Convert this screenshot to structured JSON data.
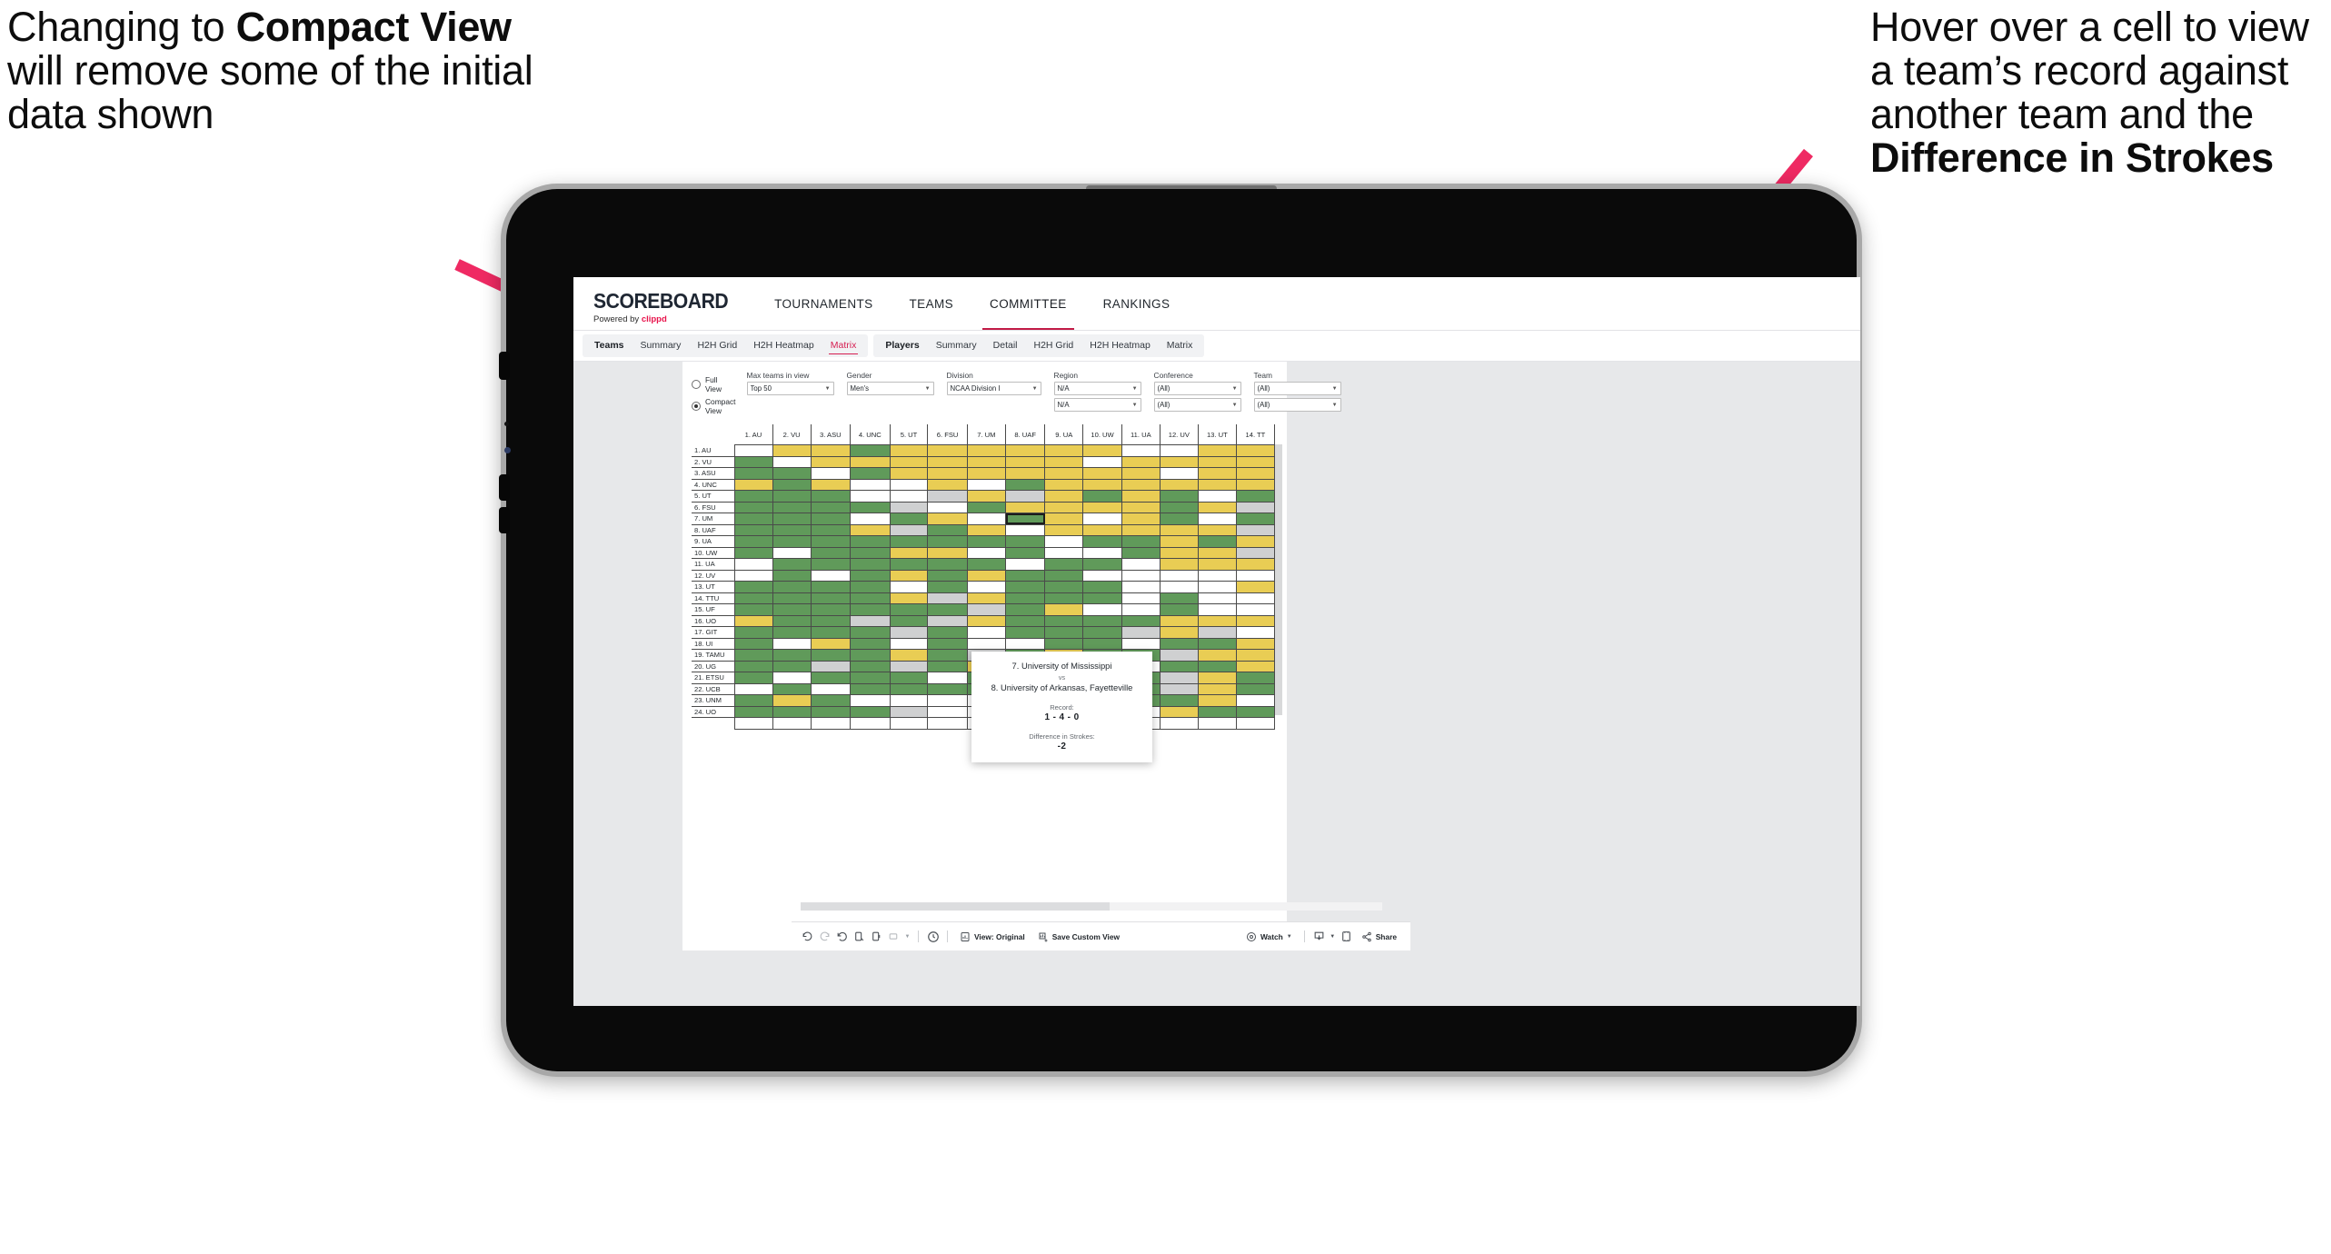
{
  "annotations": {
    "left": {
      "part1": "Changing to ",
      "bold": "Compact View",
      "part2": " will remove some of the initial data shown"
    },
    "right": {
      "part1": "Hover over a cell to view a team’s record against another team and the ",
      "bold": "Difference in Strokes",
      "part2": ""
    },
    "arrow_color": "#ef2a63"
  },
  "app": {
    "brand": {
      "title": "SCOREBOARD",
      "powered_prefix": "Powered by ",
      "powered_name": "clippd"
    },
    "topnav": [
      {
        "label": "TOURNAMENTS",
        "active": false
      },
      {
        "label": "TEAMS",
        "active": false
      },
      {
        "label": "COMMITTEE",
        "active": true
      },
      {
        "label": "RANKINGS",
        "active": false
      }
    ],
    "subnav": {
      "group_teams": {
        "head": "Teams",
        "items": [
          "Summary",
          "H2H Grid",
          "H2H Heatmap",
          "Matrix"
        ],
        "selected": "Matrix"
      },
      "group_players": {
        "head": "Players",
        "items": [
          "Summary",
          "Detail",
          "H2H Grid",
          "H2H Heatmap",
          "Matrix"
        ],
        "selected": ""
      }
    },
    "filters": {
      "view_mode": {
        "options": [
          "Full View",
          "Compact View"
        ],
        "selected": "Compact View"
      },
      "max_teams": {
        "label": "Max teams in view",
        "value": "Top 50"
      },
      "gender": {
        "label": "Gender",
        "value": "Men's"
      },
      "division": {
        "label": "Division",
        "value": "NCAA Division I"
      },
      "region": {
        "label": "Region",
        "value1": "N/A",
        "value2": "N/A"
      },
      "conference": {
        "label": "Conference",
        "value1": "(All)",
        "value2": "(All)"
      },
      "team": {
        "label": "Team",
        "value1": "(All)",
        "value2": "(All)"
      }
    },
    "tooltip": {
      "team_a": "7. University of Mississippi",
      "vs": "vs",
      "team_b": "8. University of Arkansas, Fayetteville",
      "record_label": "Record:",
      "record_value": "1 - 4 - 0",
      "diff_label": "Difference in Strokes:",
      "diff_value": "-2"
    },
    "toolbar": {
      "view_label": "View: Original",
      "save_label": "Save Custom View",
      "watch_label": "Watch",
      "share_label": "Share"
    }
  },
  "chart_data": {
    "type": "heatmap",
    "title": "Team Head-to-Head Matrix",
    "legend": {
      "green": "#609a5a",
      "yellow": "#e9cd54",
      "grey": "#cfd0d1",
      "white": "#ffffff"
    },
    "columns": [
      "1. AU",
      "2. VU",
      "3. ASU",
      "4. UNC",
      "5. UT",
      "6. FSU",
      "7. UM",
      "8. UAF",
      "9. UA",
      "10. UW",
      "11. UA",
      "12. UV",
      "13. UT",
      "14. TT"
    ],
    "rows": [
      "1. AU",
      "2. VU",
      "3. ASU",
      "4. UNC",
      "5. UT",
      "6. FSU",
      "7. UM",
      "8. UAF",
      "9. UA",
      "10. UW",
      "11. UA",
      "12. UV",
      "13. UT",
      "14. TTU",
      "15. UF",
      "16. UO",
      "17. GIT",
      "18. UI",
      "19. TAMU",
      "20. UG",
      "21. ETSU",
      "22. UCB",
      "23. UNM",
      "24. UO"
    ],
    "cells": [
      [
        "n",
        "y",
        "y",
        "g",
        "y",
        "y",
        "y",
        "y",
        "y",
        "y",
        "w",
        "w",
        "y",
        "y"
      ],
      [
        "g",
        "n",
        "y",
        "y",
        "y",
        "y",
        "y",
        "y",
        "y",
        "w",
        "y",
        "y",
        "y",
        "y"
      ],
      [
        "g",
        "g",
        "n",
        "g",
        "y",
        "y",
        "y",
        "y",
        "y",
        "y",
        "y",
        "w",
        "y",
        "y"
      ],
      [
        "y",
        "g",
        "y",
        "w",
        "w",
        "y",
        "w",
        "g",
        "y",
        "y",
        "y",
        "y",
        "y",
        "y"
      ],
      [
        "g",
        "g",
        "g",
        "w",
        "w",
        "s",
        "y",
        "s",
        "y",
        "g",
        "y",
        "g",
        "w",
        "g"
      ],
      [
        "g",
        "g",
        "g",
        "g",
        "s",
        "w",
        "g",
        "y",
        "y",
        "y",
        "y",
        "g",
        "y",
        "s"
      ],
      [
        "g",
        "g",
        "g",
        "w",
        "g",
        "y",
        "w",
        "g",
        "y",
        "w",
        "y",
        "g",
        "w",
        "g"
      ],
      [
        "g",
        "g",
        "g",
        "y",
        "s",
        "g",
        "y",
        "w",
        "y",
        "y",
        "y",
        "y",
        "y",
        "s"
      ],
      [
        "g",
        "g",
        "g",
        "g",
        "g",
        "g",
        "g",
        "g",
        "w",
        "g",
        "g",
        "y",
        "g",
        "y"
      ],
      [
        "g",
        "w",
        "g",
        "g",
        "y",
        "y",
        "w",
        "g",
        "w",
        "w",
        "g",
        "y",
        "y",
        "s"
      ],
      [
        "w",
        "g",
        "g",
        "g",
        "g",
        "g",
        "g",
        "w",
        "g",
        "g",
        "w",
        "y",
        "y",
        "y"
      ],
      [
        "w",
        "g",
        "w",
        "g",
        "y",
        "g",
        "y",
        "g",
        "g",
        "w",
        "w",
        "w",
        "w",
        "w"
      ],
      [
        "g",
        "g",
        "g",
        "g",
        "w",
        "g",
        "w",
        "g",
        "g",
        "g",
        "w",
        "w",
        "w",
        "y"
      ],
      [
        "g",
        "g",
        "g",
        "g",
        "y",
        "s",
        "y",
        "g",
        "g",
        "g",
        "w",
        "g",
        "w",
        "w"
      ],
      [
        "g",
        "g",
        "g",
        "g",
        "g",
        "g",
        "s",
        "g",
        "y",
        "w",
        "w",
        "g",
        "w",
        "w"
      ],
      [
        "y",
        "g",
        "g",
        "s",
        "g",
        "s",
        "y",
        "g",
        "g",
        "g",
        "g",
        "y",
        "y",
        "y"
      ],
      [
        "g",
        "g",
        "g",
        "g",
        "s",
        "g",
        "w",
        "g",
        "g",
        "g",
        "s",
        "y",
        "s",
        "w"
      ],
      [
        "g",
        "w",
        "y",
        "g",
        "w",
        "g",
        "w",
        "w",
        "g",
        "g",
        "w",
        "g",
        "g",
        "y"
      ],
      [
        "g",
        "g",
        "g",
        "g",
        "y",
        "g",
        "s",
        "g",
        "y",
        "g",
        "g",
        "s",
        "y",
        "y"
      ],
      [
        "g",
        "g",
        "s",
        "g",
        "s",
        "g",
        "y",
        "g",
        "g",
        "w",
        "w",
        "g",
        "g",
        "y"
      ],
      [
        "g",
        "w",
        "g",
        "g",
        "g",
        "w",
        "g",
        "g",
        "w",
        "y",
        "g",
        "s",
        "y",
        "g"
      ],
      [
        "w",
        "g",
        "w",
        "g",
        "g",
        "g",
        "g",
        "g",
        "g",
        "w",
        "g",
        "s",
        "y",
        "g"
      ],
      [
        "g",
        "y",
        "g",
        "w",
        "w",
        "w",
        "w",
        "g",
        "g",
        "w",
        "g",
        "g",
        "y",
        "w"
      ],
      [
        "g",
        "g",
        "g",
        "g",
        "s",
        "w",
        "w",
        "w",
        "g",
        "y",
        "w",
        "y",
        "g",
        "g"
      ]
    ],
    "highlighted_cell": {
      "row": "7. UM",
      "col": "8. UAF",
      "record": "1 - 4 - 0",
      "difference_in_strokes": -2
    }
  }
}
